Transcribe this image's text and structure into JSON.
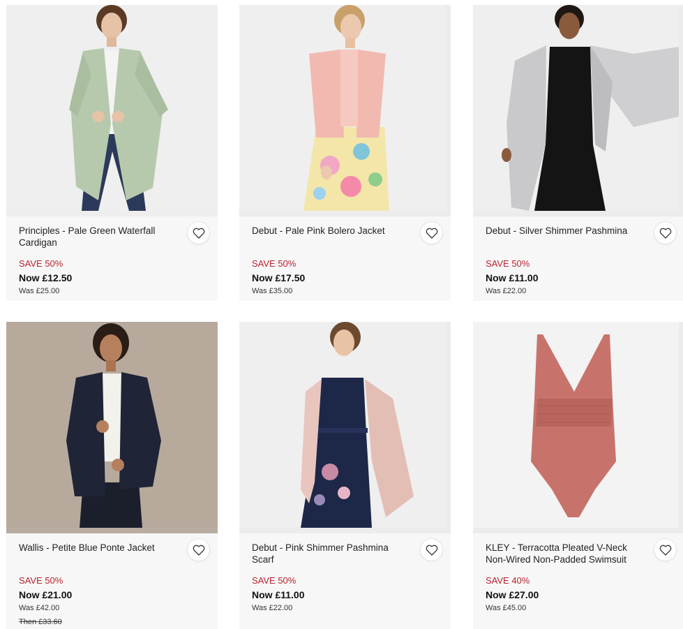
{
  "products": [
    {
      "name": "Principles - Pale Green Waterfall Cardigan",
      "save": "SAVE 50%",
      "now": "Now £12.50",
      "was": "Was £25.00",
      "then": ""
    },
    {
      "name": "Debut - Pale Pink Bolero Jacket",
      "save": "SAVE 50%",
      "now": "Now £17.50",
      "was": "Was £35.00",
      "then": ""
    },
    {
      "name": "Debut - Silver Shimmer Pashmina",
      "save": "SAVE 50%",
      "now": "Now £11.00",
      "was": "Was £22.00",
      "then": ""
    },
    {
      "name": "Wallis - Petite Blue Ponte Jacket",
      "save": "SAVE 50%",
      "now": "Now £21.00",
      "was": "Was £42.00",
      "then": "Then £33.60"
    },
    {
      "name": "Debut - Pink Shimmer Pashmina Scarf",
      "save": "SAVE 50%",
      "now": "Now £11.00",
      "was": "Was £22.00",
      "then": ""
    },
    {
      "name": "KLEY - Terracotta Pleated V-Neck Non-Wired Non-Padded Swimsuit",
      "save": "SAVE 40%",
      "now": "Now £27.00",
      "was": "Was £45.00",
      "then": ""
    }
  ],
  "icons": {
    "wishlist": "heart-outline-icon"
  },
  "colors": {
    "sale_red": "#b8232f"
  }
}
